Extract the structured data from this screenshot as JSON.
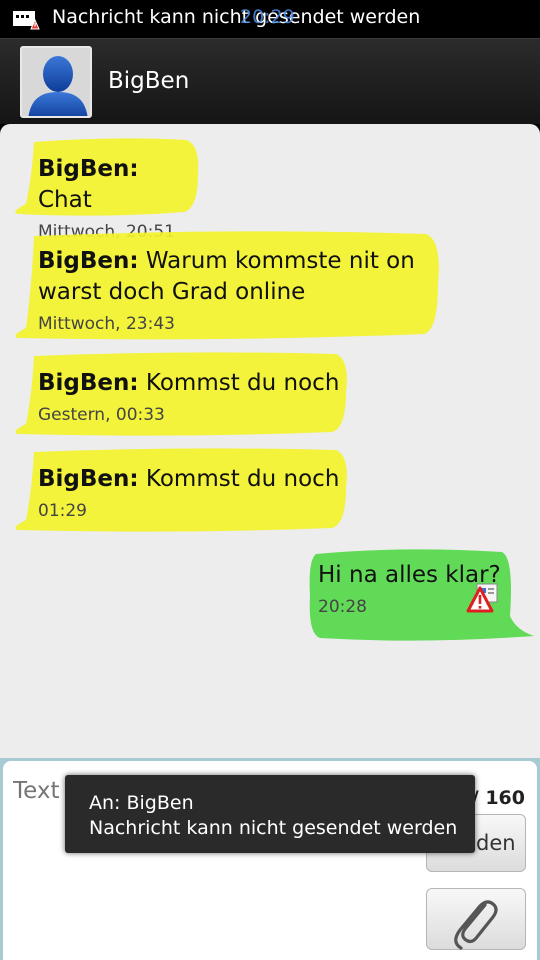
{
  "status_bar": {
    "notification": "Nachricht kann nicht gesendet werden",
    "clock": "20:29",
    "icon": "sms-failed-warning-icon"
  },
  "header": {
    "contact_name": "BigBen",
    "avatar_icon": "person-silhouette-icon"
  },
  "messages": [
    {
      "direction": "in",
      "sender": "BigBen:",
      "lines": [
        "Chat"
      ],
      "time": "Mittwoch, 20:51"
    },
    {
      "direction": "in",
      "sender": "BigBen:",
      "lines": [
        "Warum kommste nit on",
        "warst doch Grad online"
      ],
      "time": "Mittwoch, 23:43"
    },
    {
      "direction": "in",
      "sender": "BigBen:",
      "lines": [
        "Kommst du noch"
      ],
      "time": "Gestern, 00:33"
    },
    {
      "direction": "in",
      "sender": "BigBen:",
      "lines": [
        "Kommst du noch"
      ],
      "time": "01:29"
    },
    {
      "direction": "out",
      "sender": "",
      "lines": [
        "Hi na alles klar?"
      ],
      "time": "20:28",
      "status_icon": "send-failed-warning-icon"
    }
  ],
  "colors": {
    "incoming_bubble": "#f2f32a",
    "outgoing_bubble": "#55d94a",
    "compose_border": "#a7cad3",
    "clock": "#4a90e8"
  },
  "compose": {
    "placeholder": "Text hier eingeben",
    "counter": "/ 160",
    "send_label": "Senden",
    "attach_icon": "paperclip-icon"
  },
  "toast": {
    "line1": "An: BigBen",
    "line2": "Nachricht kann nicht gesendet werden"
  }
}
